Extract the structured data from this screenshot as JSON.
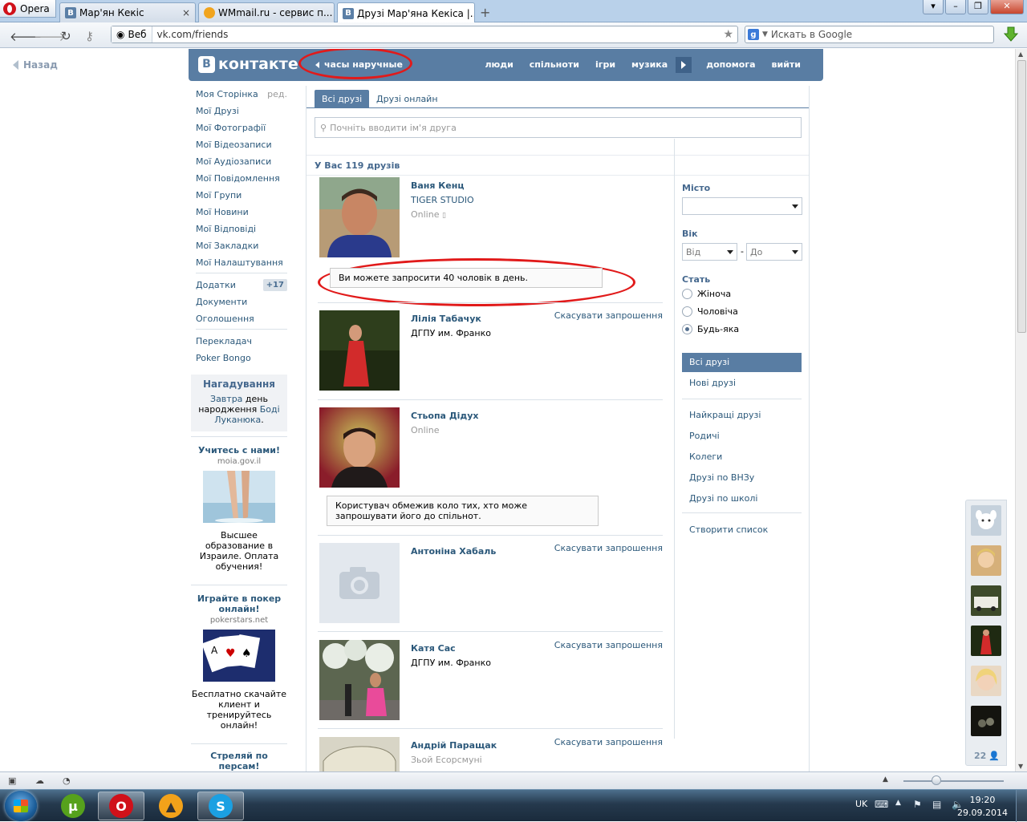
{
  "browser": {
    "menu_label": "Opera",
    "tabs": [
      {
        "title": "Мар'ян Кекіс",
        "favicon": "vk-favicon"
      },
      {
        "title": "WMmail.ru - сервис п...",
        "favicon": "wmmail-favicon"
      },
      {
        "title": "Друзі Мар'яна Кекіса |...",
        "favicon": "vk-favicon",
        "active": true
      }
    ],
    "address": {
      "mode_label": "Веб",
      "url": "vk.com/friends"
    },
    "search_placeholder": "Искать в Google",
    "accent": "#b9d1ea"
  },
  "page": {
    "back_label": "Назад",
    "header": {
      "logo_text": "контакте",
      "logo_letter": "В",
      "status": "часы наручные",
      "menu": [
        "люди",
        "спільноти",
        "ігри",
        "музика",
        "допомога",
        "вийти"
      ],
      "brand_color": "#597da3"
    },
    "left_menu": {
      "items": [
        {
          "label": "Моя Сторінка",
          "extra": "ред."
        },
        {
          "label": "Мої Друзі"
        },
        {
          "label": "Мої Фотографії"
        },
        {
          "label": "Мої Відеозаписи"
        },
        {
          "label": "Мої Аудіозаписи"
        },
        {
          "label": "Мої Повідомлення"
        },
        {
          "label": "Мої Групи"
        },
        {
          "label": "Мої Новини"
        },
        {
          "label": "Мої Відповіді"
        },
        {
          "label": "Мої Закладки"
        },
        {
          "label": "Мої Налаштування"
        }
      ],
      "apps": [
        {
          "label": "Додатки",
          "badge": "+17"
        },
        {
          "label": "Документи"
        },
        {
          "label": "Оголошення"
        }
      ],
      "extras": [
        {
          "label": "Перекладач"
        },
        {
          "label": "Poker Bongo"
        }
      ],
      "reminder": {
        "title": "Нагадування",
        "part1": "Завтра",
        "part2": " день народження ",
        "part3": "Боді Луканюка",
        "part4": "."
      },
      "ads": [
        {
          "title": "Учитесь с нами!",
          "domain": "moia.gov.il",
          "text": "Высшее образование в Израиле. Оплата обучения!",
          "image": "beach-photo"
        },
        {
          "title": "Играйте в покер онлайн!",
          "domain": "pokerstars.net",
          "text": "Бесплатно скачайте клиент и тренируйтесь онлайн!",
          "image": "playing-cards-photo"
        },
        {
          "title": "Стреляй по персам!"
        }
      ]
    },
    "content": {
      "tabs": [
        "Всі друзі",
        "Друзі онлайн"
      ],
      "search_placeholder": "Почніть вводити ім'я друга",
      "count_label": "У Вас 119 друзів",
      "friends": [
        {
          "name": "Ваня Кенц",
          "line2": "TIGER STUDIO",
          "line3": "Online",
          "action": ""
        },
        {
          "name": "Лілія Табачук",
          "line2": "ДГПУ им. Франко",
          "line3": "",
          "action": "Скасувати запрошення"
        },
        {
          "name": "Стьопа Дідух",
          "line2": "",
          "line3": "Online",
          "action": ""
        },
        {
          "name": "Антоніна Хабаль",
          "line2": "",
          "line3": "",
          "action": "Скасувати запрошення"
        },
        {
          "name": "Катя Сас",
          "line2": "ДГПУ им. Франко",
          "line3": "",
          "action": "Скасувати запрошення"
        },
        {
          "name": "Андрій Паращак",
          "line2": "Зьой Есорсмуні",
          "line3": "",
          "action": "Скасувати запрошення"
        }
      ],
      "notice_invite": "Ви можете запросити 40 чоловік в день.",
      "notice_restricted": "Користувач обмежив коло тих, хто може запрошувати його до спільнот."
    },
    "filters": {
      "city_label": "Місто",
      "city_value": "",
      "age_label": "Вік",
      "age_from": "Від",
      "age_dash": "-",
      "age_to": "До",
      "sex_label": "Стать",
      "sex_options": [
        {
          "label": "Жіноча",
          "selected": false
        },
        {
          "label": "Чоловіча",
          "selected": false
        },
        {
          "label": "Будь-яка",
          "selected": true
        }
      ],
      "sections": [
        "Всі друзі",
        "Нові друзі"
      ],
      "lists": [
        "Найкращі друзі",
        "Родичі",
        "Колеги",
        "Друзі по ВНЗу",
        "Друзі по школі"
      ],
      "create_list": "Створити список"
    },
    "chat": {
      "online_count": "22"
    }
  },
  "taskbar": {
    "apps": [
      "utorrent-icon",
      "opera-icon",
      "aimp-icon",
      "skype-icon"
    ],
    "lang": "UK",
    "time": "19:20",
    "date": "29.09.2014"
  }
}
